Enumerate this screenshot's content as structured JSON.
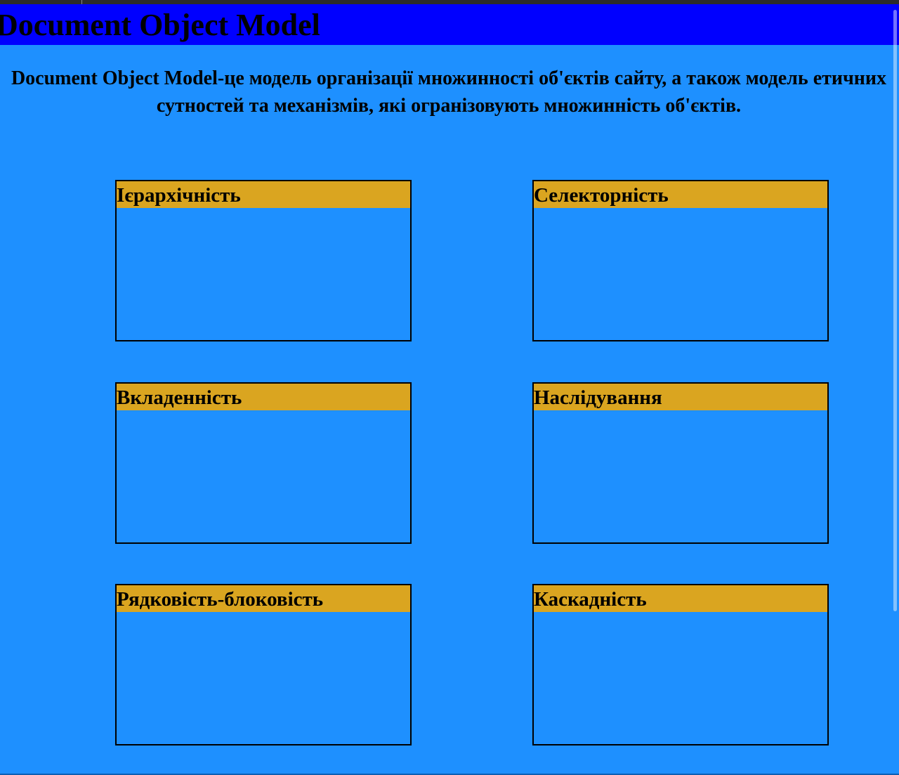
{
  "header": {
    "title": "Document Object Model"
  },
  "intro": {
    "text": "Document Object Model-це модель організації множинності об'єктів сайту, а також модель етичних сутностей та механізмів, які огранізовують множинність об'єктів."
  },
  "cards": [
    {
      "title": "Ієрархічність"
    },
    {
      "title": "Селекторність"
    },
    {
      "title": "Вкладенність"
    },
    {
      "title": "Наслідування"
    },
    {
      "title": "Рядковість-блоковість"
    },
    {
      "title": "Каскадність"
    }
  ],
  "colors": {
    "page_background": "#1e90ff",
    "header_background": "#0000ff",
    "card_header_background": "#daa520",
    "border": "#000000"
  }
}
